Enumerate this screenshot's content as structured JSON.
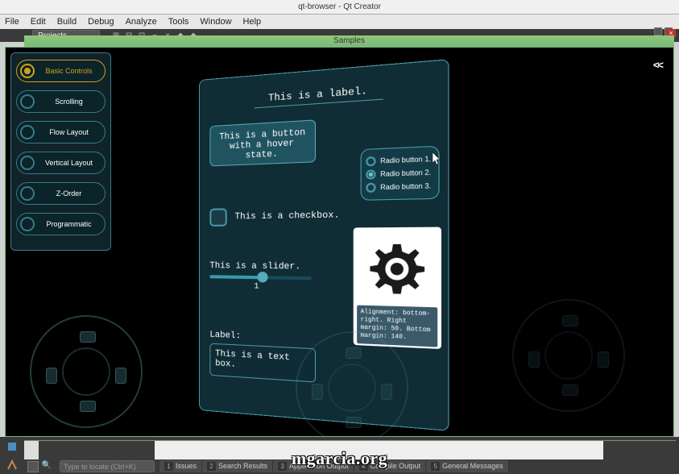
{
  "titlebar": "qt-browser - Qt Creator",
  "menus": [
    "File",
    "Edit",
    "Build",
    "Debug",
    "Analyze",
    "Tools",
    "Window",
    "Help"
  ],
  "projects_combo": "Projects",
  "samples_title": "Samples",
  "back_btn": "<<",
  "nav": [
    {
      "label": "Basic Controls",
      "active": true
    },
    {
      "label": "Scrolling",
      "active": false
    },
    {
      "label": "Flow Layout",
      "active": false
    },
    {
      "label": "Vertical Layout",
      "active": false
    },
    {
      "label": "Z-Order",
      "active": false
    },
    {
      "label": "Programmatic",
      "active": false
    }
  ],
  "panel": {
    "title": "This is a label.",
    "hover_button": "This is a button with a hover state.",
    "checkbox_label": "This is a checkbox.",
    "radios": [
      "Radio button 1.",
      "Radio button 2.",
      "Radio button 3."
    ],
    "radio_selected": 1,
    "slider_label": "This is a slider.",
    "slider_value": "1",
    "textbox_label": "Label:",
    "textbox_value": "This is a text box.",
    "gear_caption": "Alignment: bottom-right.\nRight margin: 50.\nBottom margin: 140."
  },
  "search_placeholder": "Type to locate (Ctrl+K)",
  "status_tabs": [
    {
      "n": "1",
      "label": "Issues"
    },
    {
      "n": "2",
      "label": "Search Results"
    },
    {
      "n": "3",
      "label": "Application Output"
    },
    {
      "n": "4",
      "label": "Compile Output"
    },
    {
      "n": "5",
      "label": "General Messages"
    }
  ],
  "watermark": "mgarcia.org"
}
